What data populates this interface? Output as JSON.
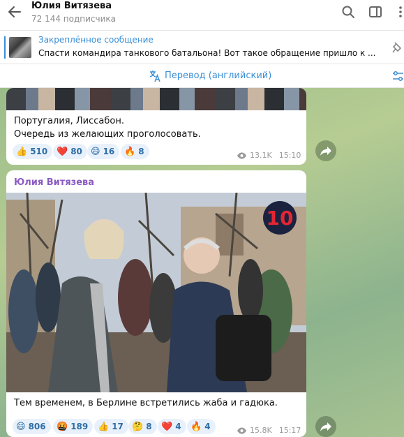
{
  "header": {
    "title": "Юлия Витязева",
    "subscribers": "72 144 подписчика"
  },
  "pinned": {
    "label": "Закреплённое сообщение",
    "text": "Спасти командира танкового батальона!  Вот такое обращение пришло к ..."
  },
  "translate": {
    "label": "Перевод (английский)"
  },
  "messages": [
    {
      "caption_line1": "Португалия, Лиссабон.",
      "caption_line2": "Очередь из желающих проголосовать.",
      "reactions": [
        {
          "emoji": "👍",
          "count": "510"
        },
        {
          "emoji": "❤️",
          "count": "80"
        },
        {
          "emoji": "😄",
          "count": "16"
        },
        {
          "emoji": "🔥",
          "count": "8"
        }
      ],
      "views": "13.1K",
      "time": "15:10"
    },
    {
      "sender": "Юлия Витязева",
      "caption": "Тем временем, в Берлине встретились жаба и гадюка.",
      "reactions": [
        {
          "emoji": "😄",
          "count": "806"
        },
        {
          "emoji": "🤬",
          "count": "189"
        },
        {
          "emoji": "👍",
          "count": "17"
        },
        {
          "emoji": "🤔",
          "count": "8"
        },
        {
          "emoji": "❤️",
          "count": "4"
        },
        {
          "emoji": "🔥",
          "count": "4"
        }
      ],
      "views": "15.8K",
      "time": "15:17",
      "watermark": "10"
    }
  ],
  "colors": {
    "accent": "#3a8fd6",
    "sender": "#8a5cc2",
    "reaction_bg": "#e8f1fb"
  }
}
